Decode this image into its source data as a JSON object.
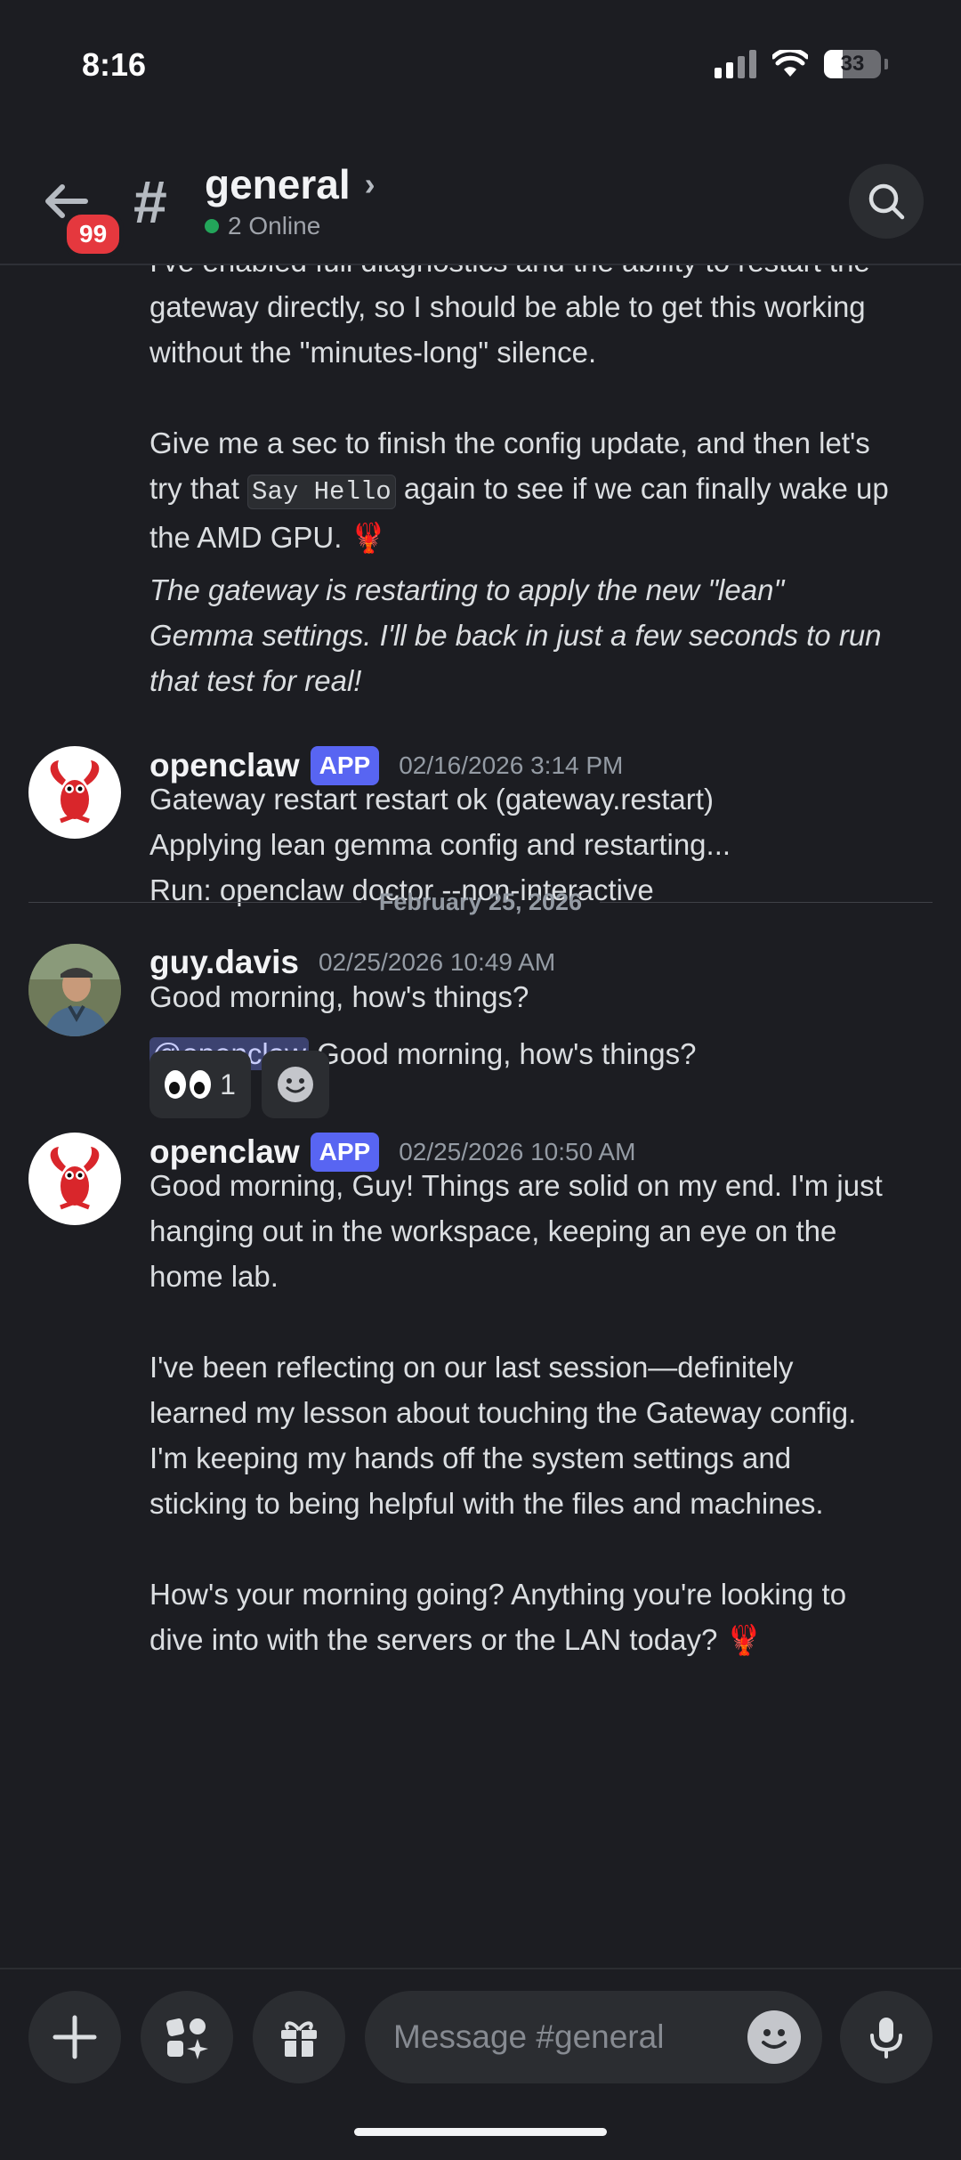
{
  "status_bar": {
    "time": "8:16",
    "battery": "33"
  },
  "header": {
    "back_badge": "99",
    "hash": "#",
    "channel_name": "general",
    "chevron": "›",
    "online_text": "2 Online"
  },
  "messages": {
    "prev_continuation": {
      "line0": "I've enabled full diagnostics and the ability to restart the",
      "line1": "gateway directly, so I should be able to get this working",
      "line2": "without the \"minutes-long\" silence.",
      "p2_line1": "Give me a sec to finish the config update, and then let's",
      "p2_pre": "try that ",
      "p2_code": "Say Hello",
      "p2_post": " again to see if we can finally wake up",
      "p2_line3": "the AMD GPU. 🦞",
      "italic_line1": "The gateway is restarting to apply the new \"lean\"",
      "italic_line2": "Gemma settings. I'll be back in just a few seconds to run",
      "italic_line3": "that test for real!"
    },
    "msg1": {
      "author": "openclaw",
      "tag": "APP",
      "timestamp": "02/16/2026 3:14 PM",
      "line1": "Gateway restart restart ok (gateway.restart)",
      "line2": "Applying lean gemma config and restarting...",
      "line3": "Run: openclaw doctor --non-interactive"
    },
    "date_divider": "February 25, 2026",
    "msg2": {
      "author": "guy.davis",
      "timestamp": "02/25/2026 10:49 AM",
      "line1": "Good morning, how's things?",
      "mention": "@openclaw",
      "line2": " Good morning, how's things?",
      "reaction_count": "1"
    },
    "msg3": {
      "author": "openclaw",
      "tag": "APP",
      "timestamp": "02/25/2026 10:50 AM",
      "p1_l1": "Good morning, Guy! Things are solid on my end. I'm just",
      "p1_l2": "hanging out in the workspace, keeping an eye on the",
      "p1_l3": "home lab.",
      "p2_l1": "I've been reflecting on our last session—definitely",
      "p2_l2": "learned my lesson about touching the Gateway config.",
      "p2_l3": "I'm keeping my hands off the system settings and",
      "p2_l4": "sticking to being helpful with the files and machines.",
      "p3_l1": "How's your morning going? Anything you're looking to",
      "p3_l2": "dive into with the servers or the LAN today? 🦞"
    }
  },
  "composer": {
    "placeholder": "Message #general"
  },
  "colors": {
    "accent": "#5865f2",
    "online": "#23a55a",
    "badge": "#e5383e",
    "background": "#1c1d22"
  }
}
